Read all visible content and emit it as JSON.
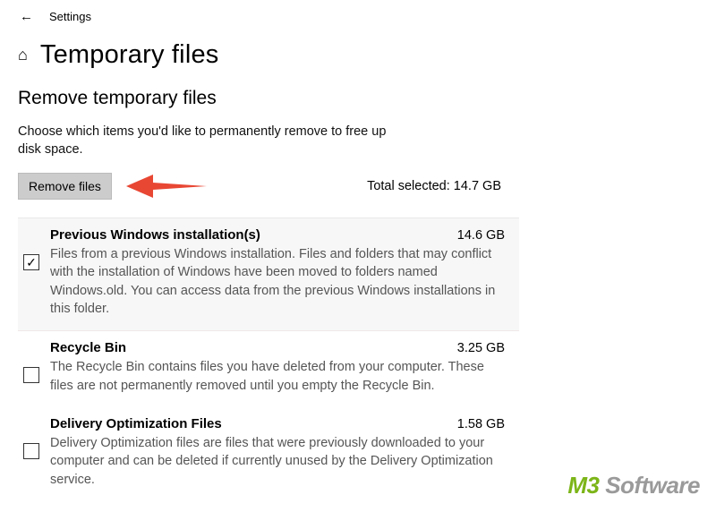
{
  "titlebar": {
    "label": "Settings"
  },
  "header": {
    "title": "Temporary files"
  },
  "section": {
    "heading": "Remove temporary files",
    "description": "Choose which items you'd like to permanently remove to free up disk space.",
    "remove_button": "Remove files",
    "total_selected_label": "Total selected: 14.7 GB"
  },
  "items": [
    {
      "title": "Previous Windows installation(s)",
      "size": "14.6 GB",
      "checked": true,
      "highlighted": true,
      "description": "Files from a previous Windows installation.  Files and folders that may conflict with the installation of Windows have been moved to folders named Windows.old.  You can access data from the previous Windows installations in this folder."
    },
    {
      "title": "Recycle Bin",
      "size": "3.25 GB",
      "checked": false,
      "highlighted": false,
      "description": "The Recycle Bin contains files you have deleted from your computer. These files are not permanently removed until you empty the Recycle Bin."
    },
    {
      "title": "Delivery Optimization Files",
      "size": "1.58 GB",
      "checked": false,
      "highlighted": false,
      "description": "Delivery Optimization files are files that were previously downloaded to your computer and can be deleted if currently unused by the Delivery Optimization service."
    }
  ],
  "watermark": {
    "brand": "M3",
    "suffix": " Software"
  }
}
